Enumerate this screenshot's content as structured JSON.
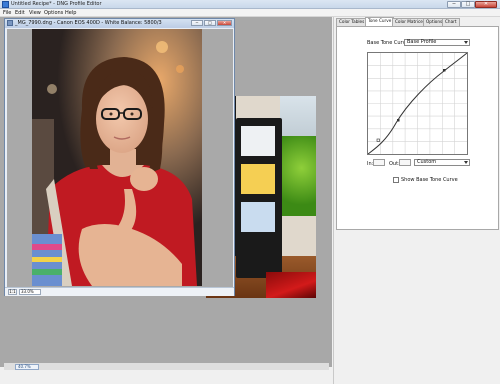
{
  "window": {
    "title": "Untitled Recipe* - DNG Profile Editor",
    "minimize": "─",
    "maximize": "□",
    "close": "✕"
  },
  "menu": [
    "File",
    "Edit",
    "View",
    "Options",
    "Help"
  ],
  "image_window": {
    "title": "_MG_7990.dng - Canon EOS 400D - White Balance: 5800/3",
    "zoom": "33.0%",
    "zoom_icon": "1:1"
  },
  "workspace": {
    "zoom": "40.7%"
  },
  "tabs": [
    {
      "label": "Color Tables",
      "active": false
    },
    {
      "label": "Tone Curve",
      "active": true
    },
    {
      "label": "Color Matrices",
      "active": false
    },
    {
      "label": "Options",
      "active": false
    },
    {
      "label": "Chart",
      "active": false
    }
  ],
  "tone_curve": {
    "base_label": "Base Tone Curve:",
    "base_value": "Base Profile",
    "in_label": "In:",
    "in_value": "",
    "out_label": "Out:",
    "out_value": "",
    "mode_value": "Custom",
    "show_base_label": "Show Base Tone Curve",
    "show_base_checked": false
  },
  "colors": {
    "accent": "#3a7bd5",
    "checker_swatches": [
      "#eef1f3",
      "#f5cf53",
      "#c9dcef"
    ]
  }
}
